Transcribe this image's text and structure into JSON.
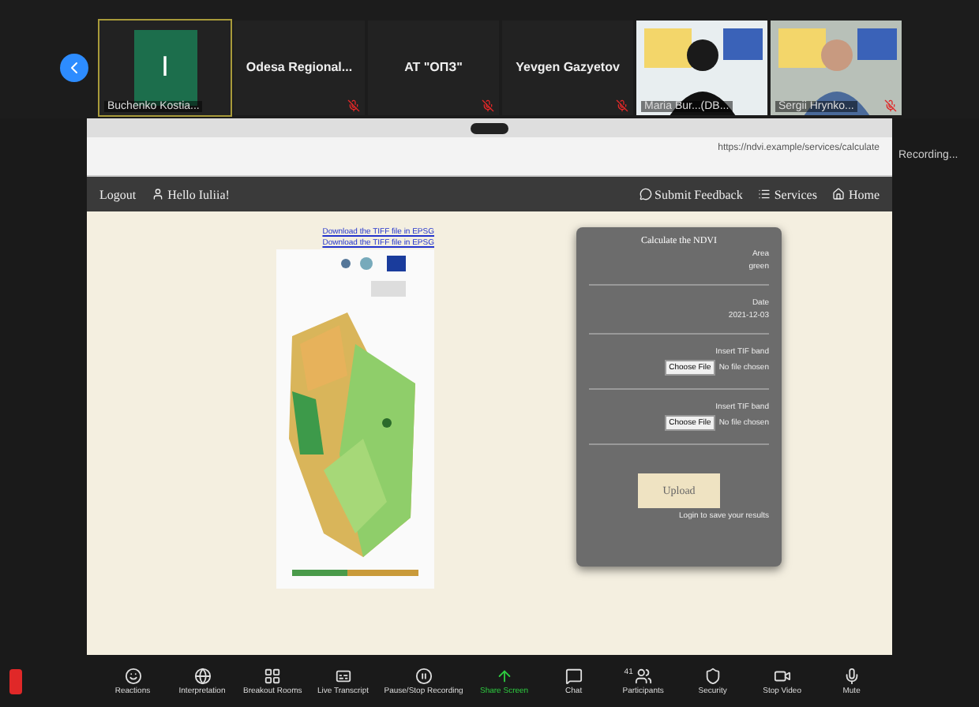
{
  "participants": [
    {
      "kind": "avatar",
      "initial": "I",
      "name": "Buchenko Kostia...",
      "muted": false,
      "active": true
    },
    {
      "kind": "name",
      "name": "Odesa Regional...",
      "muted": true,
      "active": false
    },
    {
      "kind": "name",
      "name": "AT \"ОПЗ\"",
      "muted": true,
      "active": false
    },
    {
      "kind": "name",
      "name": "Yevgen Gazyetov",
      "muted": true,
      "active": false
    },
    {
      "kind": "video",
      "name": "Maria Bur...(DB...",
      "muted": false,
      "active": false
    },
    {
      "kind": "video",
      "name": "Sergii Hrynko...",
      "muted": true,
      "active": false
    }
  ],
  "recording": "Recording...",
  "browser": {
    "url": "https://ndvi.example/services/calculate"
  },
  "site": {
    "nav_left": [
      "Logout",
      "Hello Iuliia!"
    ],
    "nav_right": [
      "Submit Feedback",
      "Services",
      "Home"
    ],
    "links": [
      "Download the TIFF file in EPSG",
      "Download the TIFF file in EPSG"
    ],
    "form": {
      "title": "Calculate the NDVI",
      "fields": [
        {
          "label": "Area",
          "value": "green"
        },
        {
          "label": "Date",
          "value": "2021-12-03"
        }
      ],
      "files": [
        {
          "label": "Insert TIF band",
          "button": "Choose File",
          "status": "No file chosen"
        },
        {
          "label": "Insert TIF band",
          "button": "Choose File",
          "status": "No file chosen"
        }
      ],
      "submit": "Upload",
      "note": "Login to save your results"
    }
  },
  "toolbar": [
    {
      "kind": "smile",
      "label": "Reactions"
    },
    {
      "kind": "globe",
      "label": "Interpretation"
    },
    {
      "kind": "grid",
      "label": "Breakout Rooms"
    },
    {
      "kind": "cc",
      "label": "Live Transcript"
    },
    {
      "kind": "rec",
      "label": "Pause/Stop Recording"
    },
    {
      "kind": "share",
      "label": "Share Screen"
    },
    {
      "kind": "chat",
      "label": "Chat"
    },
    {
      "kind": "people",
      "label": "Participants",
      "count": "41"
    },
    {
      "kind": "shield",
      "label": "Security"
    },
    {
      "kind": "video",
      "label": "Stop Video"
    },
    {
      "kind": "mic",
      "label": "Mute"
    }
  ]
}
